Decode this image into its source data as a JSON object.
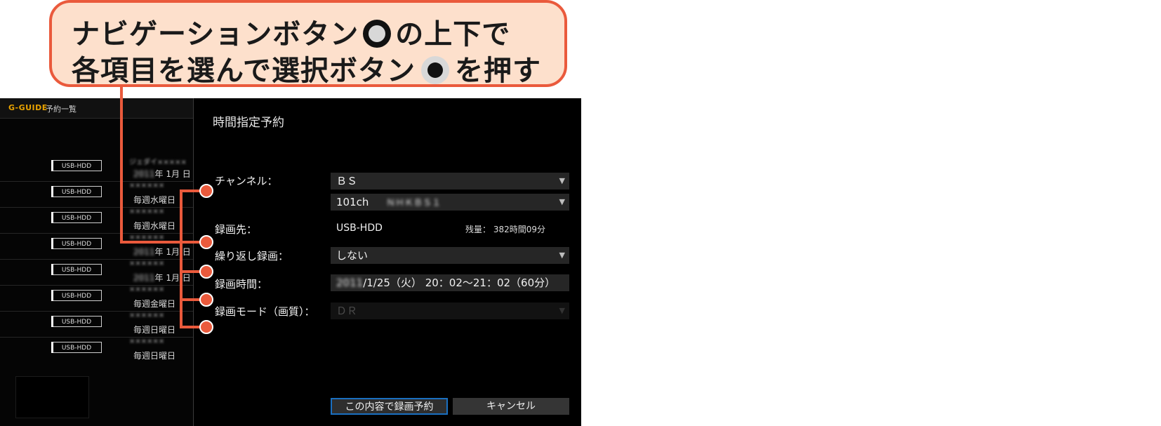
{
  "callout": {
    "line1_a": "ナビゲーションボタン",
    "line1_b": "の上下で",
    "line2_a": "各項目を選んで選択ボタン",
    "line2_b": "を押す"
  },
  "left_pane": {
    "logo": "G-GUIDE",
    "title": "予約一覧",
    "rows": [
      {
        "tag": "USB-HDD",
        "name": "ジェダイ×××××",
        "sub_blur": "2011",
        "sub": "年 1月 日"
      },
      {
        "tag": "USB-HDD",
        "name": "××××××",
        "sub_blur": "",
        "sub": "毎週水曜日"
      },
      {
        "tag": "USB-HDD",
        "name": "××××××",
        "sub_blur": "",
        "sub": "毎週水曜日"
      },
      {
        "tag": "USB-HDD",
        "name": "××××××",
        "sub_blur": "2011",
        "sub": "年 1月 日"
      },
      {
        "tag": "USB-HDD",
        "name": "××××××",
        "sub_blur": "2011",
        "sub": "年 1月 日"
      },
      {
        "tag": "USB-HDD",
        "name": "××××××",
        "sub_blur": "",
        "sub": "毎週金曜日"
      },
      {
        "tag": "USB-HDD",
        "name": "××××××",
        "sub_blur": "",
        "sub": "毎週日曜日"
      },
      {
        "tag": "USB-HDD",
        "name": "××××××",
        "sub_blur": "",
        "sub": "毎週日曜日"
      }
    ]
  },
  "dialog": {
    "title": "時間指定予約",
    "labels": {
      "channel": "チャンネル：",
      "destination": "録画先：",
      "repeat": "繰り返し録画：",
      "time": "録画時間：",
      "mode": "録画モード（画質）："
    },
    "channel_type": "ＢＳ",
    "channel_number": "101ch",
    "channel_name": "ＮＨＫＢＳ１",
    "destination_value": "USB-HDD",
    "remaining": "残量： 382時間09分",
    "repeat_value": "しない",
    "time_date_blur": "2011",
    "time_value": "/1/25（火） 20：02～21：02（60分）",
    "mode_value": "ＤＲ",
    "ok_button": "この内容で録画予約",
    "cancel_button": "キャンセル"
  },
  "colors": {
    "callout_fill": "#fde0cc",
    "callout_border": "#ea5a3c",
    "focus_border": "#1a6fc0",
    "logo": "#e8a200"
  }
}
